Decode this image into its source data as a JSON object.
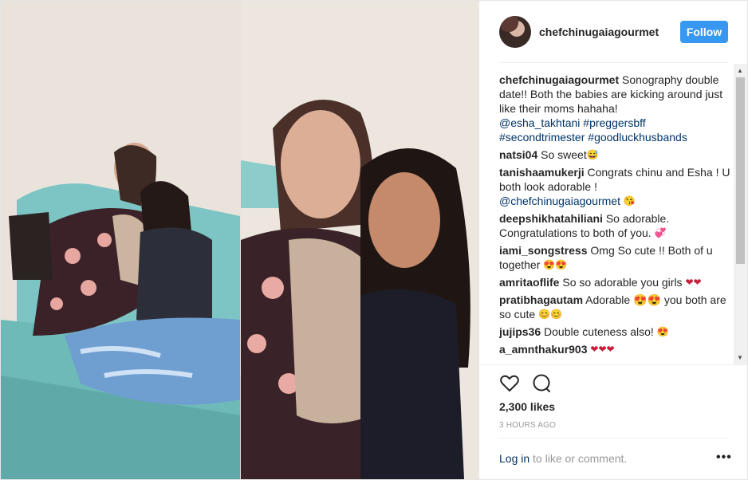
{
  "post": {
    "username": "chefchinugaiagourmet",
    "follow_label": "Follow",
    "likes": "2,300 likes",
    "timestamp": "3 HOURS AGO",
    "footer_login": "Log in",
    "footer_text": " to like or comment.",
    "more_label": "•••"
  },
  "comments": [
    {
      "user": "chefchinugaiagourmet",
      "text": " Sonography double date!! Both the babies are kicking around just like their moms hahaha! ",
      "tags": [
        "@esha_takhtani",
        "#preggersbff",
        "#secondtrimester",
        "#goodluckhusbands"
      ],
      "emoji": ""
    },
    {
      "user": "natsi04",
      "text": " So sweet",
      "tags": [],
      "emoji": "😅"
    },
    {
      "user": "tanishaamukerji",
      "text": " Congrats chinu and Esha ! U both look adorable ! ",
      "tags": [
        "@chefchinugaiagourmet"
      ],
      "emoji": "😘"
    },
    {
      "user": "deepshikhatahiliani",
      "text": " So adorable. Congratulations to both of you. ",
      "tags": [],
      "emoji": "💞"
    },
    {
      "user": "iami_songstress",
      "text": " Omg So cute !! Both of u together ",
      "tags": [],
      "emoji": "😍😍"
    },
    {
      "user": "amritaoflife",
      "text": " So so adorable you girls ",
      "tags": [],
      "emoji": "❤❤"
    },
    {
      "user": "pratibhagautam",
      "text": " Adorable 😍😍 you both are so cute ",
      "tags": [],
      "emoji": "😊😊"
    },
    {
      "user": "jujips36",
      "text": " Double cuteness also! ",
      "tags": [],
      "emoji": "😍"
    },
    {
      "user": "a_amnthakur903",
      "text": " ",
      "tags": [],
      "emoji": "❤❤❤"
    }
  ]
}
